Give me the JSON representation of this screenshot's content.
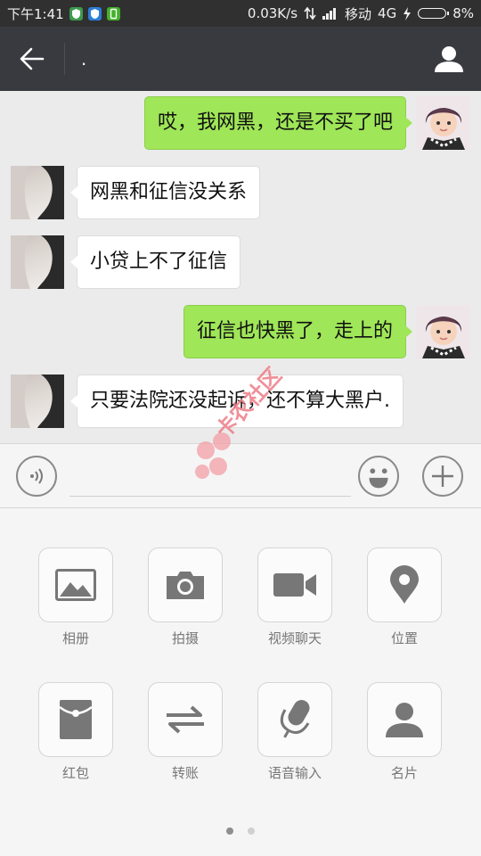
{
  "status_bar": {
    "time": "下午1:41",
    "speed": "0.03K/s",
    "carrier": "移动",
    "network": "4G",
    "battery": "8%"
  },
  "title_bar": {
    "title": ".",
    "back_icon": "arrow-left-icon",
    "profile_icon": "person-icon"
  },
  "messages": [
    {
      "from": "me",
      "text": "哎，我网黑，还是不买了吧"
    },
    {
      "from": "other",
      "text": "网黑和征信没关系"
    },
    {
      "from": "other",
      "text": "小贷上不了征信"
    },
    {
      "from": "me",
      "text": "征信也快黑了，走上的"
    },
    {
      "from": "other",
      "text": "只要法院还没起诉，还不算大黑户."
    }
  ],
  "input_bar": {
    "voice_icon": "voice-icon",
    "emoji_icon": "emoji-icon",
    "plus_icon": "plus-icon",
    "value": ""
  },
  "watermark": "卡农社区",
  "tools": [
    {
      "label": "相册",
      "icon": "gallery-icon"
    },
    {
      "label": "拍摄",
      "icon": "camera-icon"
    },
    {
      "label": "视频聊天",
      "icon": "video-icon"
    },
    {
      "label": "位置",
      "icon": "location-icon"
    },
    {
      "label": "红包",
      "icon": "red-packet-icon"
    },
    {
      "label": "转账",
      "icon": "transfer-icon"
    },
    {
      "label": "语音输入",
      "icon": "microphone-icon"
    },
    {
      "label": "名片",
      "icon": "contact-card-icon"
    }
  ],
  "colors": {
    "title_bar": "#393a3f",
    "my_bubble": "#9fe658",
    "other_bubble": "#ffffff",
    "chat_bg": "#ebebeb"
  }
}
